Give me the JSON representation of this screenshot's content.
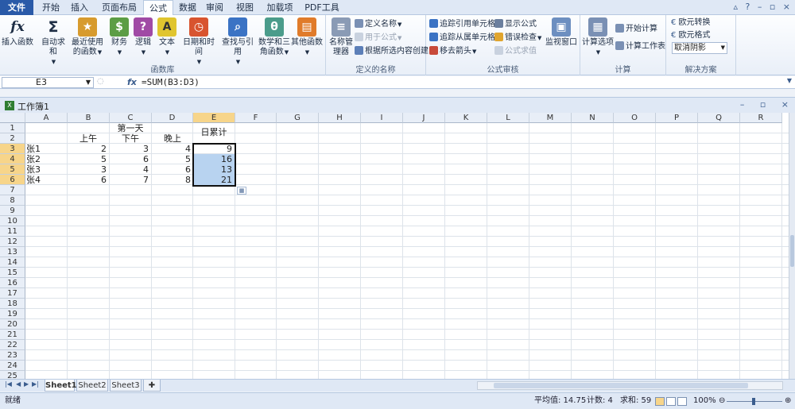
{
  "tabs": [
    "文件",
    "开始",
    "插入",
    "页面布局",
    "公式",
    "数据",
    "审阅",
    "视图",
    "加载项",
    "PDF工具"
  ],
  "ribbon": {
    "function_library": {
      "label": "函数库",
      "insert_function": "插入函数",
      "autosum": "自动求和",
      "recent": "最近使用的函数",
      "finance": "财务",
      "logical": "逻辑",
      "text": "文本",
      "datetime": "日期和时间",
      "lookup": "查找与引用",
      "math": "数学和三角函数",
      "other": "其他函数"
    },
    "defined_names": {
      "label": "定义的名称",
      "name_manager": "名称管理器",
      "define_name": "定义名称",
      "use_in_formula": "用于公式",
      "create_from_selection": "根据所选内容创建"
    },
    "formula_auditing": {
      "label": "公式审核",
      "trace_precedents": "追踪引用单元格",
      "trace_dependents": "追踪从属单元格",
      "remove_arrows": "移去箭头",
      "show_formulas": "显示公式",
      "error_check": "错误检查",
      "evaluate": "公式求值",
      "watch_window": "监视窗口"
    },
    "calculation": {
      "label": "计算",
      "options": "计算选项",
      "calc_now": "开始计算",
      "calc_sheet": "计算工作表"
    },
    "solutions": {
      "label": "解决方案",
      "euro_convert": "欧元转换",
      "euro_format": "欧元格式",
      "combo_value": "取消阴影"
    }
  },
  "formula_bar": {
    "name_box": "E3",
    "fx": "fx",
    "formula": "=SUM(B3:D3)"
  },
  "workbook": {
    "title": "工作簿1"
  },
  "sheet": {
    "columns": [
      "A",
      "B",
      "C",
      "D",
      "E",
      "F",
      "G",
      "H",
      "I",
      "J",
      "K",
      "L",
      "M",
      "N",
      "O",
      "P",
      "Q",
      "R"
    ],
    "rows": [
      "1",
      "2",
      "3",
      "4",
      "5",
      "6",
      "7",
      "8",
      "9",
      "10",
      "11",
      "12",
      "13",
      "14",
      "15",
      "16",
      "17",
      "18",
      "19",
      "20",
      "21",
      "22",
      "23",
      "24",
      "25"
    ],
    "selected_col": "E",
    "header_day": "第一天",
    "header_am": "上午",
    "header_pm": "下午",
    "header_eve": "晚上",
    "header_total": "日累计",
    "data": [
      {
        "name": "张1",
        "am": "2",
        "pm": "3",
        "eve": "4",
        "total": "9"
      },
      {
        "name": "张2",
        "am": "5",
        "pm": "6",
        "eve": "5",
        "total": "16"
      },
      {
        "name": "张3",
        "am": "3",
        "pm": "4",
        "eve": "6",
        "total": "13"
      },
      {
        "name": "张4",
        "am": "6",
        "pm": "7",
        "eve": "8",
        "total": "21"
      }
    ]
  },
  "sheet_tabs": [
    "Sheet1",
    "Sheet2",
    "Sheet3"
  ],
  "status": {
    "ready": "就绪",
    "average": "平均值: 14.75",
    "count": "计数: 4",
    "sum": "求和: 59",
    "zoom": "100%"
  }
}
